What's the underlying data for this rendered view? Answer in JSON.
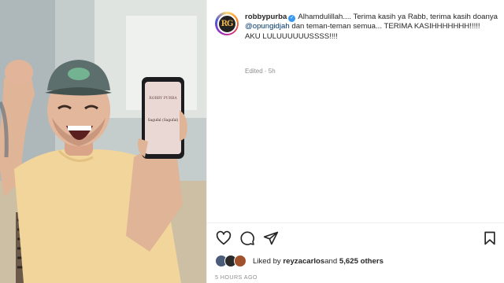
{
  "post": {
    "username": "robbypurba",
    "verified": true,
    "caption_part1": "Alhamdulillah.... Terima kasih ya Rabb, terima kasih doanya ",
    "mention": "@opungidjah",
    "caption_part2": " dan teman-teman semua... TERIMA KASIHHHHHHH!!!!!\nAKU LULUUUUUUSSSS!!!!",
    "edited_label": "Edited",
    "age": "5h",
    "liked_by_prefix": "Liked by ",
    "liked_by_user": "reyzacarlos",
    "liked_by_and": " and ",
    "others_count": "5,625 others",
    "timestamp": "5 HOURS AGO",
    "avatar_initials": "RG"
  },
  "photo": {
    "phone_header_text": "ROBBY PURBA",
    "phone_body_text": "Sagufal (Sagufal)"
  },
  "icons": {
    "like": "heart-icon",
    "comment": "comment-icon",
    "share": "paper-plane-icon",
    "save": "bookmark-icon"
  },
  "colors": {
    "mention": "#00376b",
    "verified": "#3897f0",
    "muted": "#8e8e8e"
  }
}
